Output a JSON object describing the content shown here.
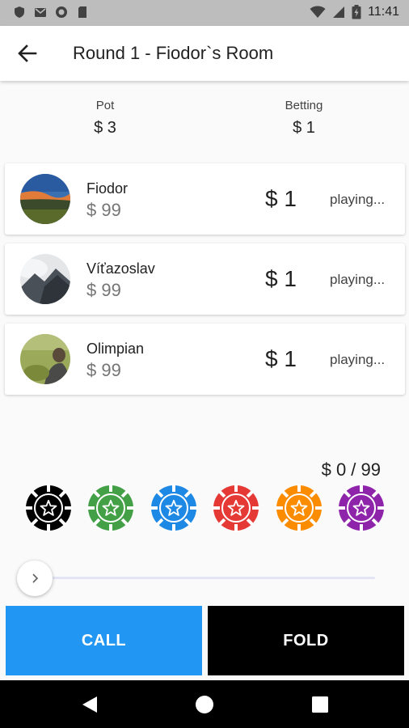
{
  "status_bar": {
    "time": "11:41"
  },
  "app_bar": {
    "title": "Round 1 - Fiodor`s Room"
  },
  "summary": {
    "pot_label": "Pot",
    "pot_value": "$ 3",
    "betting_label": "Betting",
    "betting_value": "$ 1"
  },
  "players": [
    {
      "name": "Fiodor",
      "money": "$ 99",
      "bet": "$ 1",
      "status": "playing..."
    },
    {
      "name": "Víťazoslav",
      "money": "$ 99",
      "bet": "$ 1",
      "status": "playing..."
    },
    {
      "name": "Olimpian",
      "money": "$ 99",
      "bet": "$ 1",
      "status": "playing..."
    }
  ],
  "bet": {
    "amount_text": "$ 0 / 99",
    "slider_value": 0,
    "chips": [
      {
        "color": "#000000",
        "icon": "star-icon"
      },
      {
        "color": "#43a047",
        "icon": "star-icon"
      },
      {
        "color": "#1e88e5",
        "icon": "star-icon"
      },
      {
        "color": "#e53935",
        "icon": "star-icon"
      },
      {
        "color": "#fb8c00",
        "icon": "star-icon"
      },
      {
        "color": "#8e24aa",
        "icon": "star-icon"
      }
    ]
  },
  "actions": {
    "call_label": "CALL",
    "fold_label": "FOLD"
  },
  "colors": {
    "accent": "#2196f3",
    "fold": "#000000"
  }
}
